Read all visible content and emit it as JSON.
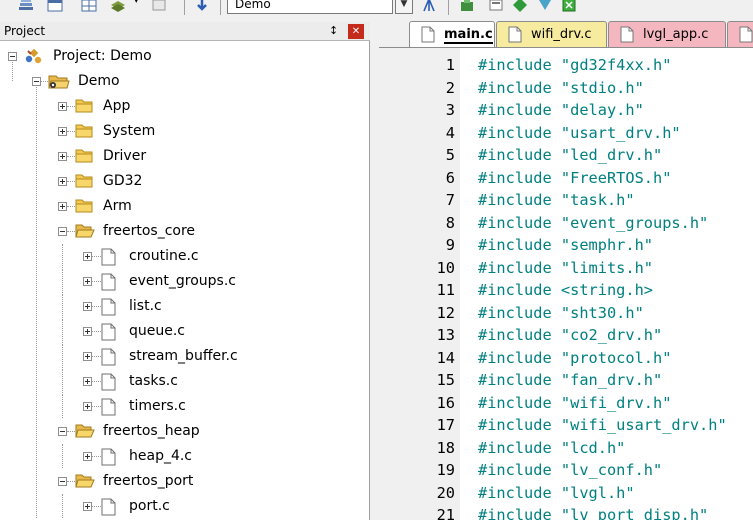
{
  "toolbar": {
    "build_target": "Demo"
  },
  "project_panel": {
    "title": "Project",
    "tree": [
      {
        "label": "Project: Demo",
        "level": 0,
        "icon": "project-icon",
        "expander": "minus"
      },
      {
        "label": "Demo",
        "level": 1,
        "icon": "target-folder-icon",
        "expander": "minus"
      },
      {
        "label": "App",
        "level": 2,
        "icon": "folder-closed-icon",
        "expander": "plus"
      },
      {
        "label": "System",
        "level": 2,
        "icon": "folder-closed-icon",
        "expander": "plus"
      },
      {
        "label": "Driver",
        "level": 2,
        "icon": "folder-closed-icon",
        "expander": "plus"
      },
      {
        "label": "GD32",
        "level": 2,
        "icon": "folder-closed-icon",
        "expander": "plus"
      },
      {
        "label": "Arm",
        "level": 2,
        "icon": "folder-closed-icon",
        "expander": "plus"
      },
      {
        "label": "freertos_core",
        "level": 2,
        "icon": "folder-open-icon",
        "expander": "minus"
      },
      {
        "label": "croutine.c",
        "level": 3,
        "icon": "file-icon",
        "expander": "plus"
      },
      {
        "label": "event_groups.c",
        "level": 3,
        "icon": "file-icon",
        "expander": "plus"
      },
      {
        "label": "list.c",
        "level": 3,
        "icon": "file-icon",
        "expander": "plus"
      },
      {
        "label": "queue.c",
        "level": 3,
        "icon": "file-icon",
        "expander": "plus"
      },
      {
        "label": "stream_buffer.c",
        "level": 3,
        "icon": "file-icon",
        "expander": "plus"
      },
      {
        "label": "tasks.c",
        "level": 3,
        "icon": "file-icon",
        "expander": "plus"
      },
      {
        "label": "timers.c",
        "level": 3,
        "icon": "file-icon",
        "expander": "plus"
      },
      {
        "label": "freertos_heap",
        "level": 2,
        "icon": "folder-open-icon",
        "expander": "minus"
      },
      {
        "label": "heap_4.c",
        "level": 3,
        "icon": "file-icon",
        "expander": "plus"
      },
      {
        "label": "freertos_port",
        "level": 2,
        "icon": "folder-open-icon",
        "expander": "minus"
      },
      {
        "label": "port.c",
        "level": 3,
        "icon": "file-icon",
        "expander": "plus"
      }
    ]
  },
  "editor": {
    "tabs": [
      {
        "label": "main.c",
        "active": true,
        "color": "#ffffff"
      },
      {
        "label": "wifi_drv.c",
        "active": false,
        "color": "#f6eb9e"
      },
      {
        "label": "lvgl_app.c",
        "active": false,
        "color": "#f5b7bf"
      }
    ],
    "lines": [
      {
        "no": "1",
        "directive": "#include",
        "target": "\"gd32f4xx.h\""
      },
      {
        "no": "2",
        "directive": "#include",
        "target": "\"stdio.h\""
      },
      {
        "no": "3",
        "directive": "#include",
        "target": "\"delay.h\""
      },
      {
        "no": "4",
        "directive": "#include",
        "target": "\"usart_drv.h\""
      },
      {
        "no": "5",
        "directive": "#include",
        "target": "\"led_drv.h\""
      },
      {
        "no": "6",
        "directive": "#include",
        "target": "\"FreeRTOS.h\""
      },
      {
        "no": "7",
        "directive": "#include",
        "target": "\"task.h\""
      },
      {
        "no": "8",
        "directive": "#include",
        "target": "\"event_groups.h\""
      },
      {
        "no": "9",
        "directive": "#include",
        "target": "\"semphr.h\""
      },
      {
        "no": "10",
        "directive": "#include",
        "target": "\"limits.h\""
      },
      {
        "no": "11",
        "directive": "#include",
        "target": "<string.h>"
      },
      {
        "no": "12",
        "directive": "#include",
        "target": "\"sht30.h\""
      },
      {
        "no": "13",
        "directive": "#include",
        "target": "\"co2_drv.h\""
      },
      {
        "no": "14",
        "directive": "#include",
        "target": "\"protocol.h\""
      },
      {
        "no": "15",
        "directive": "#include",
        "target": "\"fan_drv.h\""
      },
      {
        "no": "16",
        "directive": "#include",
        "target": "\"wifi_drv.h\""
      },
      {
        "no": "17",
        "directive": "#include",
        "target": "\"wifi_usart_drv.h\""
      },
      {
        "no": "18",
        "directive": "#include",
        "target": "\"lcd.h\""
      },
      {
        "no": "19",
        "directive": "#include",
        "target": "\"lv_conf.h\""
      },
      {
        "no": "20",
        "directive": "#include",
        "target": "\"lvgl.h\""
      },
      {
        "no": "21",
        "directive": "#include",
        "target": "\"lv_port_disp.h\""
      }
    ]
  },
  "colors": {
    "syntax_include": "#008080",
    "tab_wifi": "#f6eb9e",
    "tab_lvgl": "#f5b7bf",
    "close_button": "#c42b1c"
  }
}
